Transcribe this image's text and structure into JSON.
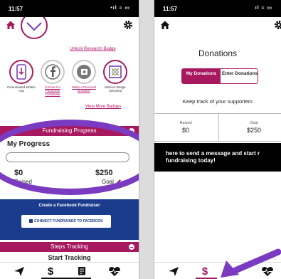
{
  "left_phone": {
    "status_time": "11:57",
    "status_icons": "•ıl ≈ ▭",
    "icons": {
      "home": "home-icon",
      "settings": "gear-icon"
    },
    "unlock_research_badge": "Unlock Research Badge",
    "badges": [
      {
        "caption": "Downloaded Mobile App",
        "icon": "phone-download-icon",
        "link": false
      },
      {
        "caption": "Connect to Facebook Fundraiser",
        "icon": "facebook-icon",
        "link": true
      },
      {
        "caption": "Make a Personal Donation",
        "icon": "donation-icon",
        "link": true
      },
      {
        "caption": "Mission Badge Unlocked",
        "icon": "mission-badge-icon",
        "link": false
      }
    ],
    "view_more_badges": "View More Badges",
    "fundraising_progress_title": "Fundraising Progress",
    "my_progress": "My Progress",
    "progress_fraction": 0,
    "raised_amount": "$0",
    "raised_label": "Raised",
    "goal_amount": "$250",
    "goal_label": "Goal",
    "facebook_title": "Create a Facebook Fundraiser",
    "facebook_button": "CONNECT FUNDRAISER TO FACEBOOK",
    "steps_tracking_title": "Steps Tracking",
    "start_tracking": "Start Tracking",
    "tabs": [
      "send-icon",
      "dollar-icon",
      "receipt-icon",
      "heart-pulse-icon"
    ]
  },
  "right_phone": {
    "status_time": "11:57",
    "status_icons": "ıl ≈ ▭",
    "title": "Donations",
    "segment_my_donations": "My Donations",
    "segment_enter_donations": "Enter Donations",
    "subtitle": "Keep track of your supporters",
    "raised_label": "Raised",
    "raised_value": "$0",
    "goal_label": "Goal",
    "goal_value": "$250",
    "message_banner": "here to send a message and start r fundraising today!",
    "tabs": [
      "send-icon",
      "dollar-icon",
      "heart-pulse-icon"
    ]
  },
  "colors": {
    "brand": "#a8185f",
    "facebook": "#1b3c8c",
    "annotation": "#7b3bc0"
  }
}
